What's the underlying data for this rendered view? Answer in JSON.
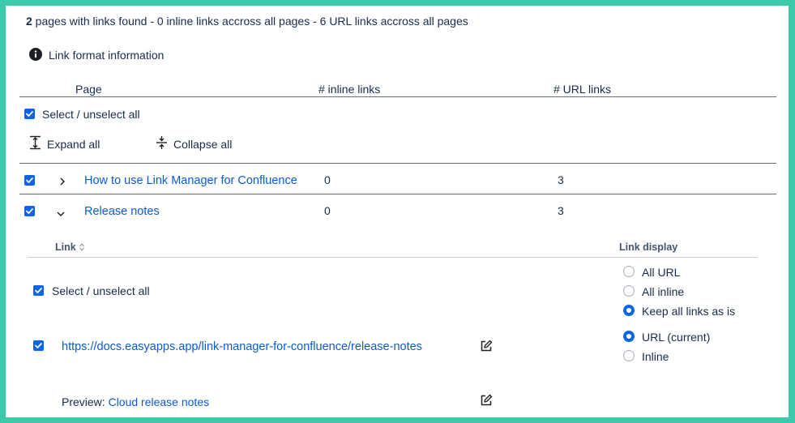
{
  "summary": {
    "count": "2",
    "text": " pages with links found - 0 inline links accross all pages - 6 URL links accross all pages"
  },
  "info": {
    "label": "Link format information"
  },
  "table": {
    "headers": {
      "page": "Page",
      "inline": "# inline links",
      "url": "# URL links"
    },
    "select_all": "Select / unselect all",
    "expand_all": "Expand all",
    "collapse_all": "Collapse all",
    "rows": [
      {
        "title": "How to use Link Manager for Confluence",
        "inline": "0",
        "url": "3",
        "expanded": false
      },
      {
        "title": "Release notes",
        "inline": "0",
        "url": "3",
        "expanded": true
      }
    ]
  },
  "detail": {
    "link_header": "Link",
    "display_header": "Link display",
    "select_all": "Select / unselect all",
    "global_options": [
      {
        "label": "All URL",
        "selected": false
      },
      {
        "label": "All inline",
        "selected": false
      },
      {
        "label": "Keep all links as is",
        "selected": true
      }
    ],
    "link": {
      "url": "https://docs.easyapps.app/link-manager-for-confluence/release-notes",
      "options": [
        {
          "label": "URL (current)",
          "selected": true
        },
        {
          "label": "Inline",
          "selected": false
        }
      ]
    },
    "preview": {
      "label": "Preview: ",
      "value": "Cloud release notes"
    }
  }
}
